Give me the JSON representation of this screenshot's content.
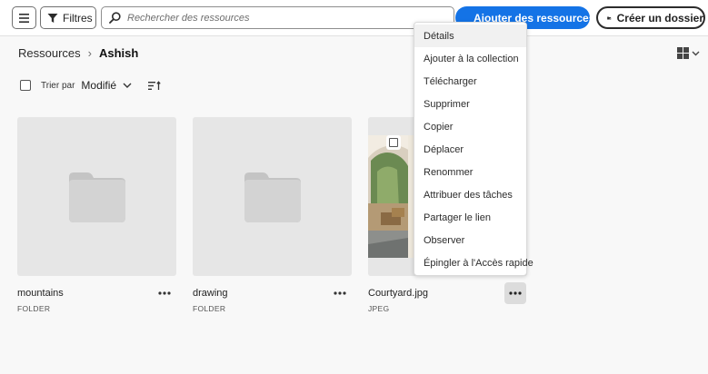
{
  "toolbar": {
    "filters_label": "Filtres",
    "search_placeholder": "Rechercher des ressources",
    "add_assets_label": "Ajouter des ressources",
    "create_folder_label": "Créer un dossier"
  },
  "breadcrumb": {
    "root": "Ressources",
    "separator": "›",
    "current": "Ashish"
  },
  "sort": {
    "label": "Trier par",
    "value": "Modifié"
  },
  "cards": [
    {
      "name": "mountains",
      "type": "FOLDER"
    },
    {
      "name": "drawing",
      "type": "FOLDER"
    },
    {
      "name": "Courtyard.jpg",
      "type": "JPEG"
    }
  ],
  "context_menu": {
    "items": [
      "Détails",
      "Ajouter à la collection",
      "Télécharger",
      "Supprimer",
      "Copier",
      "Déplacer",
      "Renommer",
      "Attribuer des tâches",
      "Partager le lien",
      "Observer",
      "Épingler à l'Accès rapide"
    ]
  },
  "colors": {
    "accent": "#1473e6",
    "background": "#f8f8f8",
    "thumbnail": "#e6e6e6",
    "folder_icon": "#c4c4c4"
  }
}
